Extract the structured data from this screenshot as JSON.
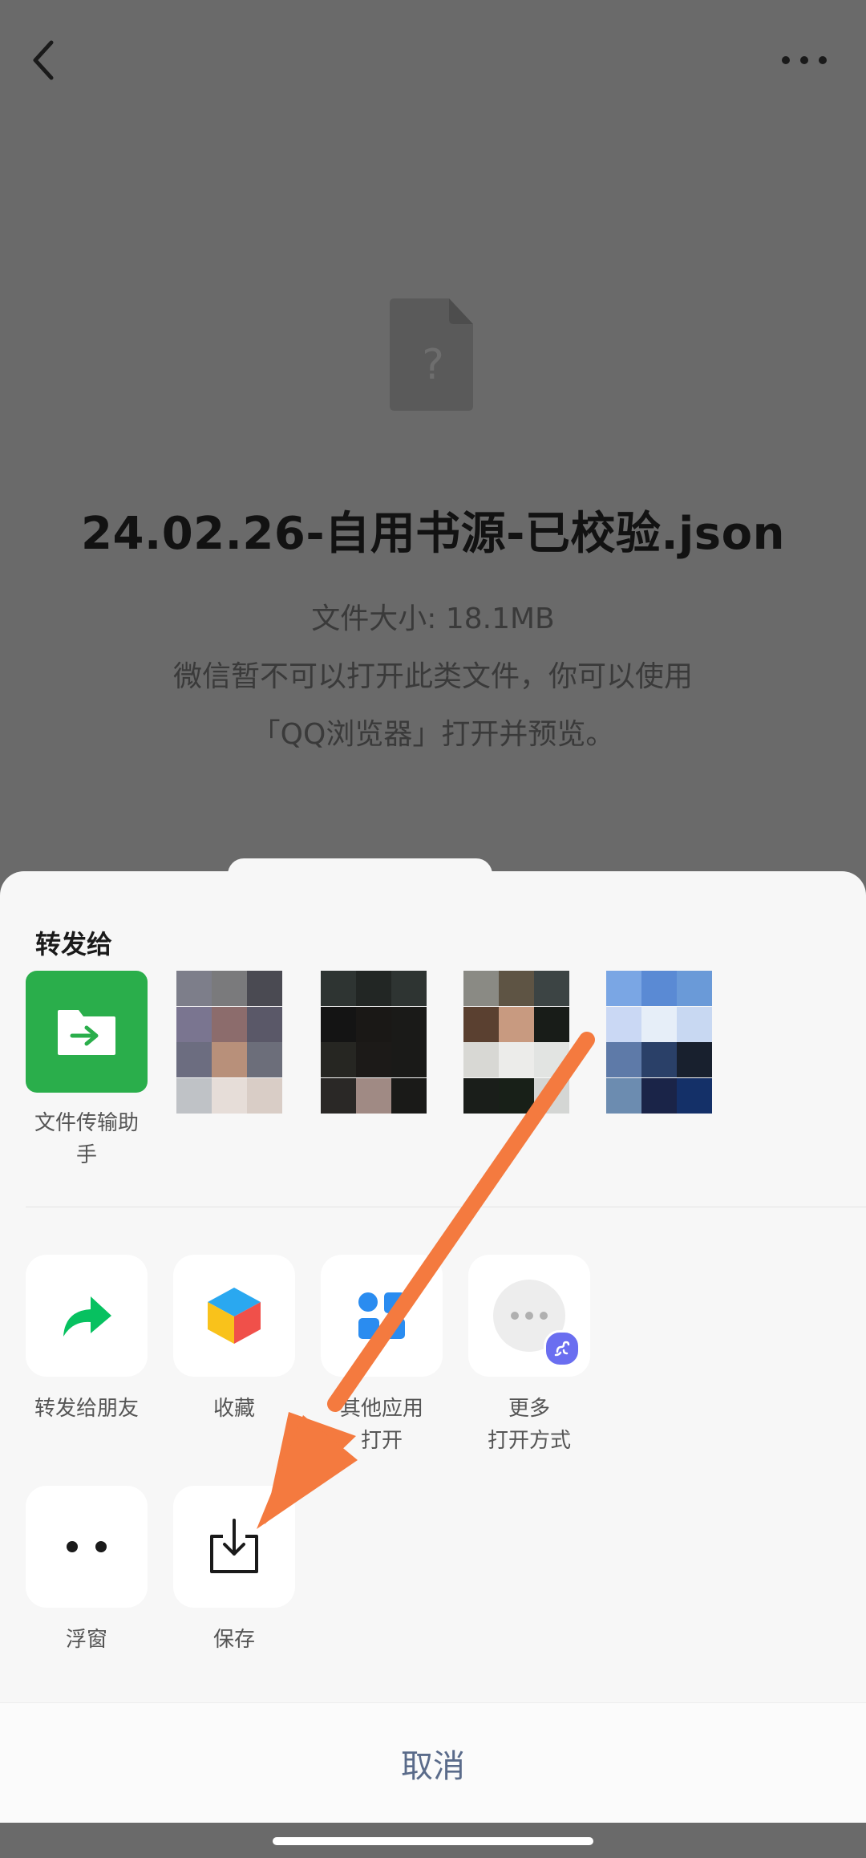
{
  "file": {
    "name": "24.02.26-自用书源-已校验.json",
    "size_text": "文件大小: 18.1MB",
    "notice_line1": "微信暂不可以打开此类文件，你可以使用",
    "notice_line2": "「QQ浏览器」打开并预览。"
  },
  "share_sheet": {
    "forward_label": "转发给",
    "contacts": [
      {
        "name": "文件传输助\n手",
        "icon": "folder-transfer-icon",
        "color": "#2aae4b"
      },
      {
        "name": "",
        "icon": "blurred-avatar"
      },
      {
        "name": "",
        "icon": "blurred-avatar"
      },
      {
        "name": "",
        "icon": "blurred-avatar"
      },
      {
        "name": "",
        "icon": "blurred-avatar"
      }
    ],
    "actions_row1": [
      {
        "label": "转发给朋友",
        "icon": "share-arrow-icon"
      },
      {
        "label": "收藏",
        "icon": "favorites-cube-icon"
      },
      {
        "label": "其他应用\n打开",
        "icon": "other-apps-icon"
      },
      {
        "label": "更多\n打开方式",
        "icon": "more-options-icon"
      }
    ],
    "actions_row2": [
      {
        "label": "浮窗",
        "icon": "float-window-icon"
      },
      {
        "label": "保存",
        "icon": "save-download-icon"
      }
    ],
    "cancel_label": "取消"
  },
  "colors": {
    "overlay": "#6a6a6a",
    "sheet": "#f7f7f7",
    "accent_green": "#2aae4b",
    "annotation_arrow": "#f47a3f"
  }
}
